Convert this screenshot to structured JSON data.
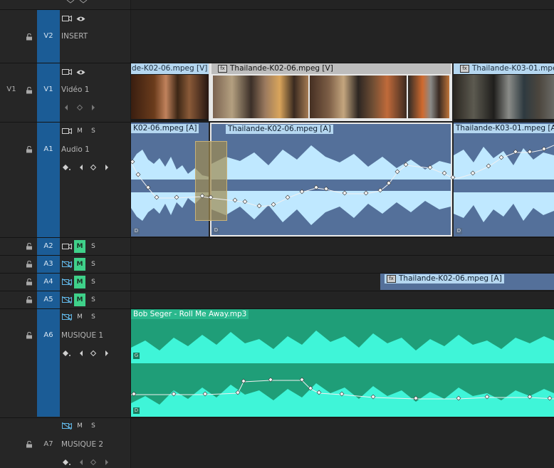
{
  "tracks": {
    "v2": {
      "id": "V2",
      "name": "INSERT"
    },
    "v1": {
      "source": "V1",
      "id": "V1",
      "name": "Vidéo 1"
    },
    "a1": {
      "id": "A1",
      "name": "Audio 1"
    },
    "a2": {
      "id": "A2"
    },
    "a3": {
      "id": "A3"
    },
    "a4": {
      "id": "A4"
    },
    "a5": {
      "id": "A5"
    },
    "a6": {
      "id": "A6",
      "name": "MUSIQUE 1"
    },
    "a7": {
      "id": "A7",
      "name": "MUSIQUE 2"
    }
  },
  "labels": {
    "mute": "M",
    "solo": "S",
    "diamond": "◇"
  },
  "clips": {
    "v1_a": "de-K02-06.mpeg [V]",
    "v1_b": "Thailande-K02-06.mpeg [V]",
    "v1_c": "Thailande-K03-01.mpeg",
    "a1_a": "K02-06.mpeg [A]",
    "a1_b": "Thailande-K02-06.mpeg [A]",
    "a1_c": "Thailande-K03-01.mpeg [A]",
    "a4_a": "Thailande-K02-06.mpeg [A]",
    "a6_a": "Bob Seger - Roll Me Away.mp3"
  },
  "tags": {
    "fx": "fx",
    "d": "D",
    "g": "G"
  },
  "colors": {
    "target": "#1b5c96",
    "mute_active": "#3fd18a",
    "video_clip_label": "#b5d7f0",
    "audio_clip": "#54709a",
    "audio_wave": "#bfe8ff",
    "music_clip": "#1f9e78",
    "music_wave": "#3ff5d8"
  }
}
